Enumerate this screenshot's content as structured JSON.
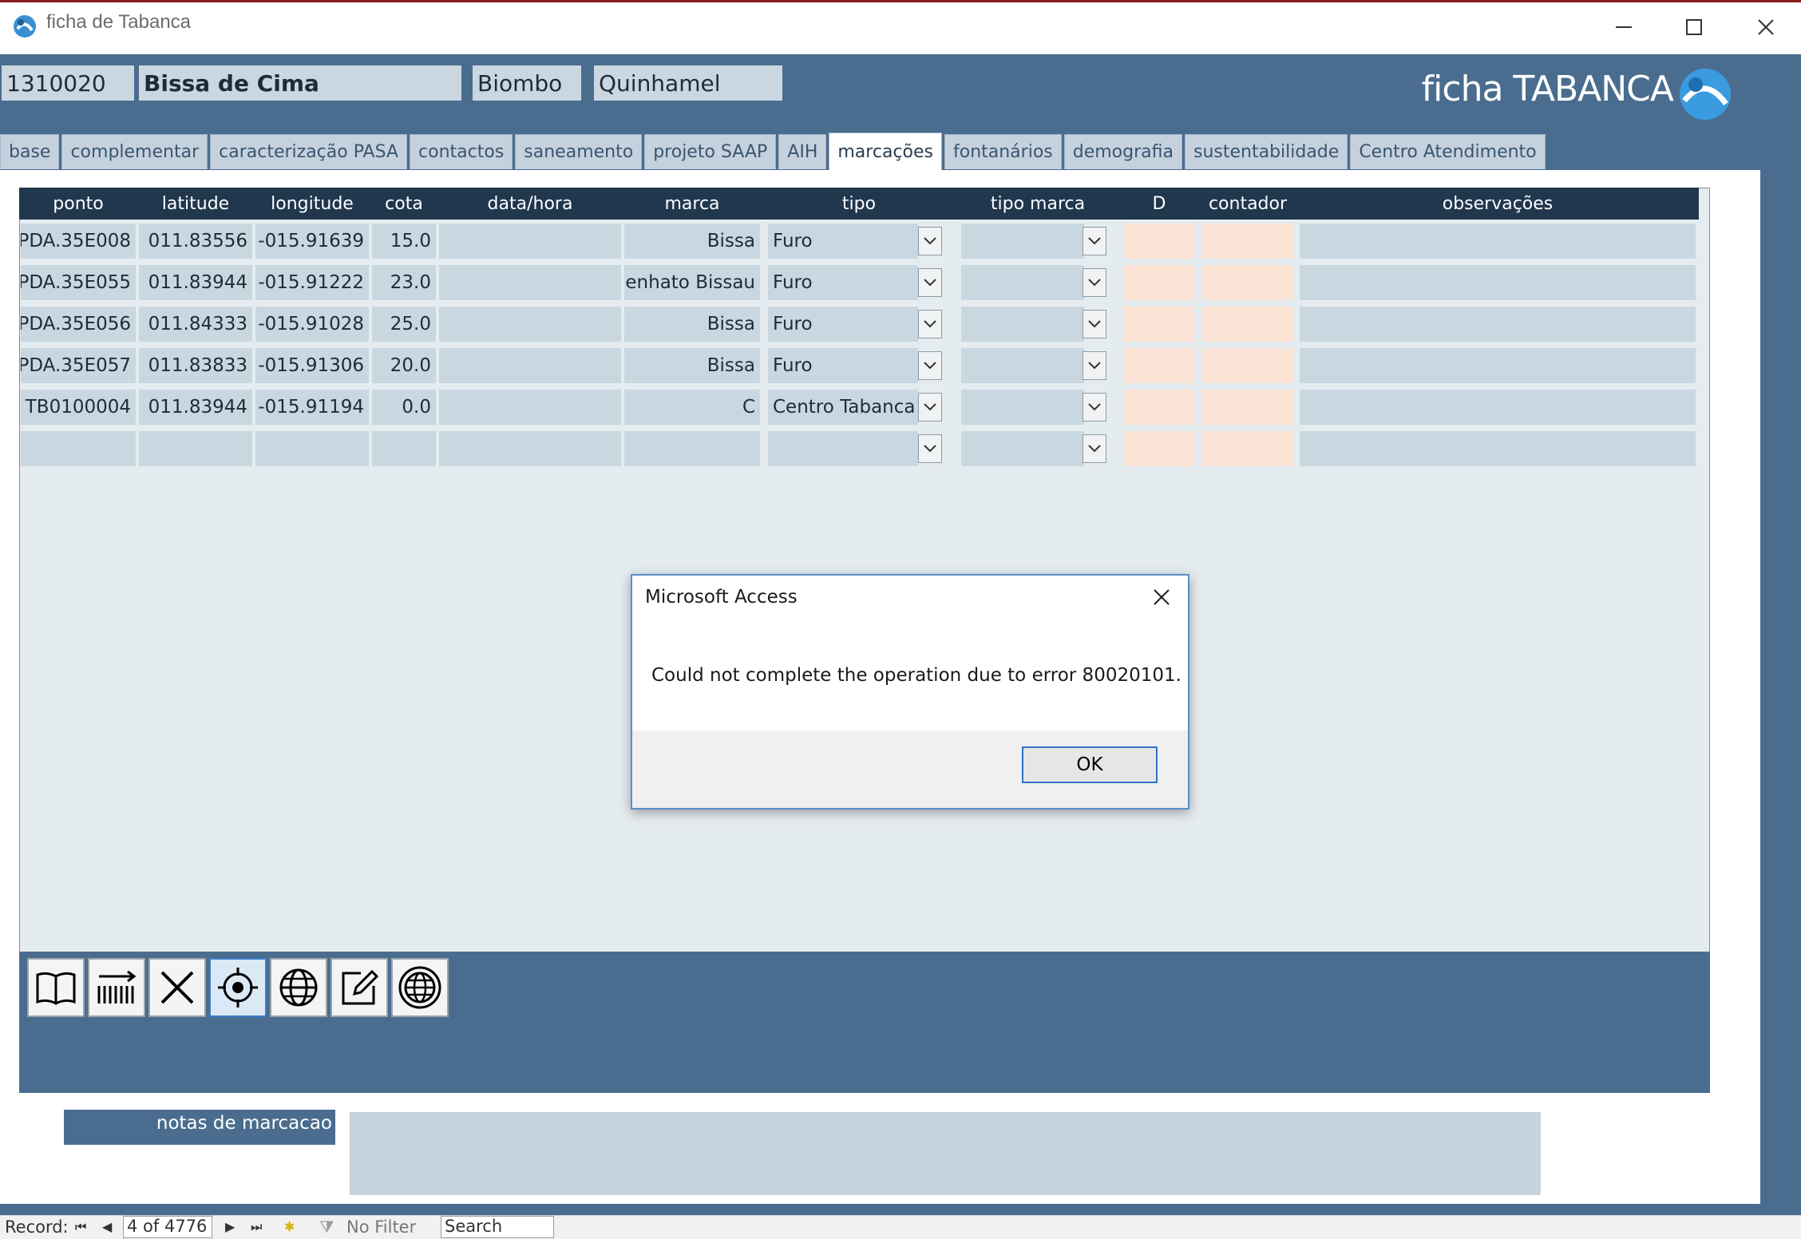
{
  "window": {
    "title": "ficha de Tabanca"
  },
  "header": {
    "code": "1310020",
    "name": "Bissa de Cima",
    "region": "Biombo",
    "sector": "Quinhamel",
    "brand": "ficha TABANCA"
  },
  "tabs": [
    {
      "label": "base"
    },
    {
      "label": "complementar"
    },
    {
      "label": "caracterização PASA"
    },
    {
      "label": "contactos"
    },
    {
      "label": "saneamento"
    },
    {
      "label": "projeto SAAP"
    },
    {
      "label": "AIH"
    },
    {
      "label": "marcações"
    },
    {
      "label": "fontanários"
    },
    {
      "label": "demografia"
    },
    {
      "label": "sustentabilidade"
    },
    {
      "label": "Centro Atendimento"
    }
  ],
  "active_tab": "marcações",
  "table": {
    "columns": [
      "ponto",
      "latitude",
      "longitude",
      "cota",
      "data/hora",
      "marca",
      "tipo",
      "tipo marca",
      "D",
      "contador",
      "observações"
    ],
    "rows": [
      {
        "ponto": "PDA.35E008",
        "latitude": "011.83556",
        "longitude": "-015.91639",
        "cota": "15.0",
        "datahora": "",
        "marca": "Bissa",
        "tipo": "Furo",
        "tipo_marca": "",
        "d": "",
        "contador": "",
        "obs": ""
      },
      {
        "ponto": "PDA.35E055",
        "latitude": "011.83944",
        "longitude": "-015.91222",
        "cota": "23.0",
        "datahora": "",
        "marca": "enhato Bissau",
        "tipo": "Furo",
        "tipo_marca": "",
        "d": "",
        "contador": "",
        "obs": ""
      },
      {
        "ponto": "PDA.35E056",
        "latitude": "011.84333",
        "longitude": "-015.91028",
        "cota": "25.0",
        "datahora": "",
        "marca": "Bissa",
        "tipo": "Furo",
        "tipo_marca": "",
        "d": "",
        "contador": "",
        "obs": ""
      },
      {
        "ponto": "PDA.35E057",
        "latitude": "011.83833",
        "longitude": "-015.91306",
        "cota": "20.0",
        "datahora": "",
        "marca": "Bissa",
        "tipo": "Furo",
        "tipo_marca": "",
        "d": "",
        "contador": "",
        "obs": ""
      },
      {
        "ponto": "TB0100004",
        "latitude": "011.83944",
        "longitude": "-015.91194",
        "cota": "0.0",
        "datahora": "",
        "marca": "C",
        "tipo": "Centro Tabanca",
        "tipo_marca": "",
        "d": "",
        "contador": "",
        "obs": ""
      },
      {
        "ponto": "",
        "latitude": "",
        "longitude": "",
        "cota": "",
        "datahora": "",
        "marca": "",
        "tipo": "",
        "tipo_marca": "",
        "d": "",
        "contador": "",
        "obs": ""
      }
    ]
  },
  "toolbar": {
    "icons": [
      "book-icon",
      "barcode-icon",
      "delete-icon",
      "target-icon",
      "globe-icon",
      "edit-icon",
      "web-icon"
    ],
    "selected": "target-icon"
  },
  "notes": {
    "label": "notas de marcacao",
    "value": ""
  },
  "statusbar": {
    "record_label": "Record:",
    "record_position": "4 of 4776",
    "filter_label": "No Filter",
    "search_label": "Search"
  },
  "dialog": {
    "title": "Microsoft Access",
    "message": "Could not complete the operation due to error 80020101.",
    "ok_label": "OK"
  },
  "colors": {
    "form_bg": "#4a6d8f",
    "header_bg": "#20374e",
    "cell_bg": "#c9d7e0",
    "peach": "#fce5d6",
    "dialog_accent": "#2f73c9"
  }
}
